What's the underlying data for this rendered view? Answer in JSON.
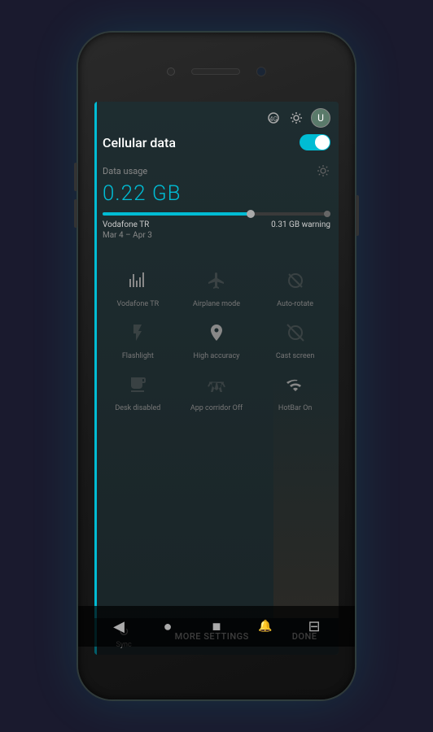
{
  "phone": {
    "top_bar": {
      "icons": [
        "settings-icon",
        "gear-icon",
        "avatar-icon"
      ],
      "avatar_initial": "U"
    },
    "cellular": {
      "title": "Cellular data",
      "toggle_on": true,
      "data_usage_label": "Data usage",
      "data_usage_amount": "0.22 GB",
      "progress_percent": 65,
      "warning_label": "0.31 GB warning",
      "carrier": "Vodafone TR",
      "date_range": "Mar 4 – Apr 3"
    },
    "quick_settings": {
      "rows": [
        [
          {
            "icon": "signal",
            "label": "Vodafone TR",
            "active": true
          },
          {
            "icon": "airplane",
            "label": "Airplane mode",
            "active": false
          },
          {
            "icon": "rotate",
            "label": "Auto-rotate",
            "active": false
          }
        ],
        [
          {
            "icon": "flashlight",
            "label": "Flashlight",
            "active": false
          },
          {
            "icon": "location",
            "label": "High accuracy",
            "active": true
          },
          {
            "icon": "cast",
            "label": "Cast screen",
            "active": false
          }
        ],
        [
          {
            "icon": "desk",
            "label": "Desk disabled",
            "active": false
          },
          {
            "icon": "accessibility",
            "label": "App corridor Off",
            "active": false
          },
          {
            "icon": "hotspot",
            "label": "HotBar On",
            "active": true
          }
        ]
      ]
    },
    "action_bar": {
      "sync_icon": "↻",
      "sync_label": "Sync",
      "more_settings": "MORE SETTINGS",
      "done": "DONE"
    },
    "nav_bar": {
      "back": "◀",
      "home": "●",
      "recent": "■",
      "notify": "🔔",
      "info": "⊟"
    }
  }
}
